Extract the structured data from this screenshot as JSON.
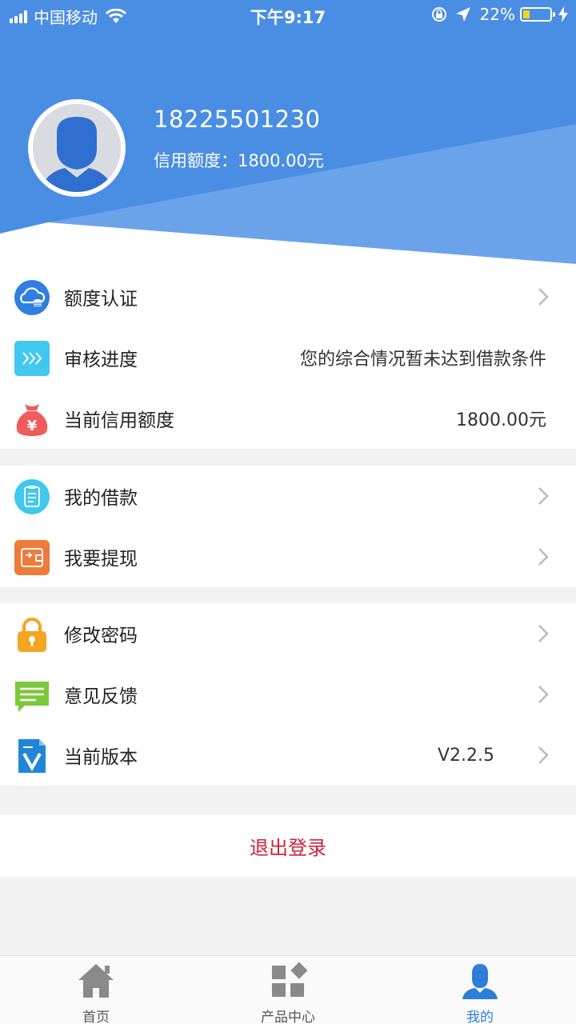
{
  "status_bar": {
    "carrier": "中国移动",
    "time": "下午9:17",
    "battery": "22%"
  },
  "profile": {
    "phone": "18225501230",
    "credit_label": "信用额度：",
    "credit_value": "1800.00元"
  },
  "menu_groups": [
    [
      {
        "label": "额度认证",
        "value": "",
        "chevron": true,
        "icon": "cloud-coins-icon"
      },
      {
        "label": "审核进度",
        "value": "您的综合情况暂未达到借款条件",
        "chevron": false,
        "icon": "progress-chevrons-icon"
      },
      {
        "label": "当前信用额度",
        "value": "1800.00元",
        "chevron": false,
        "icon": "money-bag-icon"
      }
    ],
    [
      {
        "label": "我的借款",
        "value": "",
        "chevron": true,
        "icon": "clipboard-icon"
      },
      {
        "label": "我要提现",
        "value": "",
        "chevron": true,
        "icon": "wallet-icon"
      }
    ],
    [
      {
        "label": "修改密码",
        "value": "",
        "chevron": true,
        "icon": "lock-icon"
      },
      {
        "label": "意见反馈",
        "value": "",
        "chevron": true,
        "icon": "feedback-icon"
      },
      {
        "label": "当前版本",
        "value": "V2.2.5",
        "chevron": true,
        "icon": "version-icon"
      }
    ]
  ],
  "logout_label": "退出登录",
  "tabs": [
    {
      "label": "首页",
      "icon": "home-icon",
      "active": false
    },
    {
      "label": "产品中心",
      "icon": "grid-icon",
      "active": false
    },
    {
      "label": "我的",
      "icon": "user-icon",
      "active": true
    }
  ],
  "colors": {
    "header_blue": "#4a8ee3",
    "accent_blue": "#2b7fd8",
    "logout_red": "#d0213b"
  }
}
